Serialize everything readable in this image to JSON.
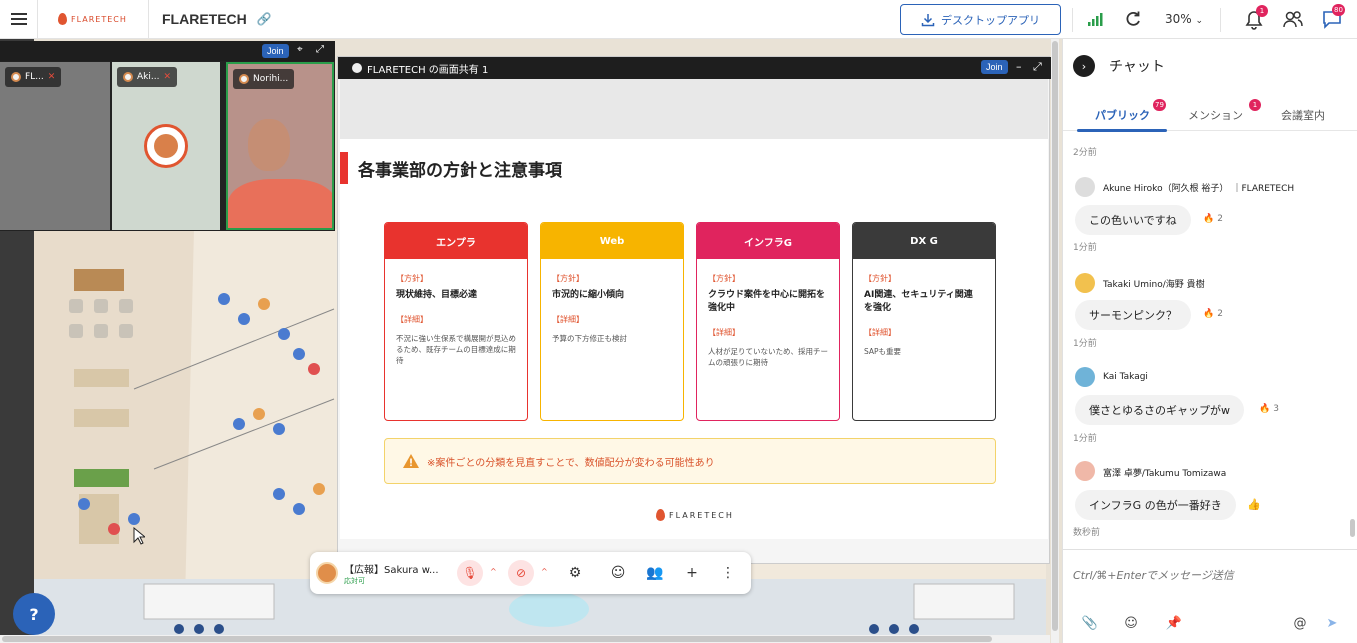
{
  "topbar": {
    "logo_text": "FLARETECH",
    "brand": "FLARETECH",
    "desktop_app_label": "デスクトップアプリ",
    "zoom": "30%",
    "bell_badge": "1",
    "chat_badge": "80"
  },
  "videos": {
    "join_label": "Join",
    "tiles": [
      {
        "name": "FL..."
      },
      {
        "name": "Aki..."
      },
      {
        "name": "Norihi..."
      }
    ]
  },
  "share": {
    "title": "FLARETECH の画面共有 1",
    "join_label": "Join",
    "slide": {
      "heading": "各事業部の方針と注意事項",
      "cards": [
        {
          "name": "エンプラ",
          "tag": "【方針】",
          "policy": "現状維持、目標必達",
          "detail_tag": "【詳細】",
          "detail": "不況に強い生保系で構展開が見込めるため、既存チームの目標達成に期待",
          "color": "#e8332e"
        },
        {
          "name": "Web",
          "tag": "【方針】",
          "policy": "市況的に縮小傾向",
          "detail_tag": "【詳細】",
          "detail": "予算の下方修正も検討",
          "color": "#f7b400"
        },
        {
          "name": "インフラG",
          "tag": "【方針】",
          "policy": "クラウド案件を中心に開拓を強化中",
          "detail_tag": "【詳細】",
          "detail": "人材が足りていないため、採用チームの頑張りに期待",
          "color": "#e0245e"
        },
        {
          "name": "DX G",
          "tag": "【方針】",
          "policy": "AI関連、セキュリティ関連を強化",
          "detail_tag": "【詳細】",
          "detail": "SAPも重要",
          "color": "#3a3a3a"
        }
      ],
      "warning": "※案件ごとの分類を見直すことで、数値配分が変わる可能性あり",
      "logo": "FLARETECH"
    }
  },
  "bottombar": {
    "name": "【広報】Sakura w...",
    "status": "応対可"
  },
  "chat": {
    "title": "チャット",
    "tabs": [
      {
        "label": "パブリック",
        "badge": "79"
      },
      {
        "label": "メンション",
        "badge": "1"
      },
      {
        "label": "会議室内"
      }
    ],
    "messages": [
      {
        "time_before": "2分前"
      },
      {
        "user": "Akune Hiroko（阿久根 裕子）",
        "org": "｜FLARETECH",
        "text": "この色いいですね",
        "reaction_count": "2",
        "time": "1分前"
      },
      {
        "user": "Takaki Umino/海野 貴樹",
        "text": "サーモンピンク？",
        "reaction_count": "2",
        "time": "1分前"
      },
      {
        "user": "Kai Takagi",
        "text": "僕さとゆるさのギャップがw",
        "reaction_count": "3",
        "time": "1分前"
      },
      {
        "user": "富澤 卓夢/Takumu Tomizawa",
        "text": "インフラG の色が一番好き",
        "time": "数秒前"
      }
    ],
    "input_placeholder": "Ctrl/⌘+Enterでメッセージ送信"
  }
}
